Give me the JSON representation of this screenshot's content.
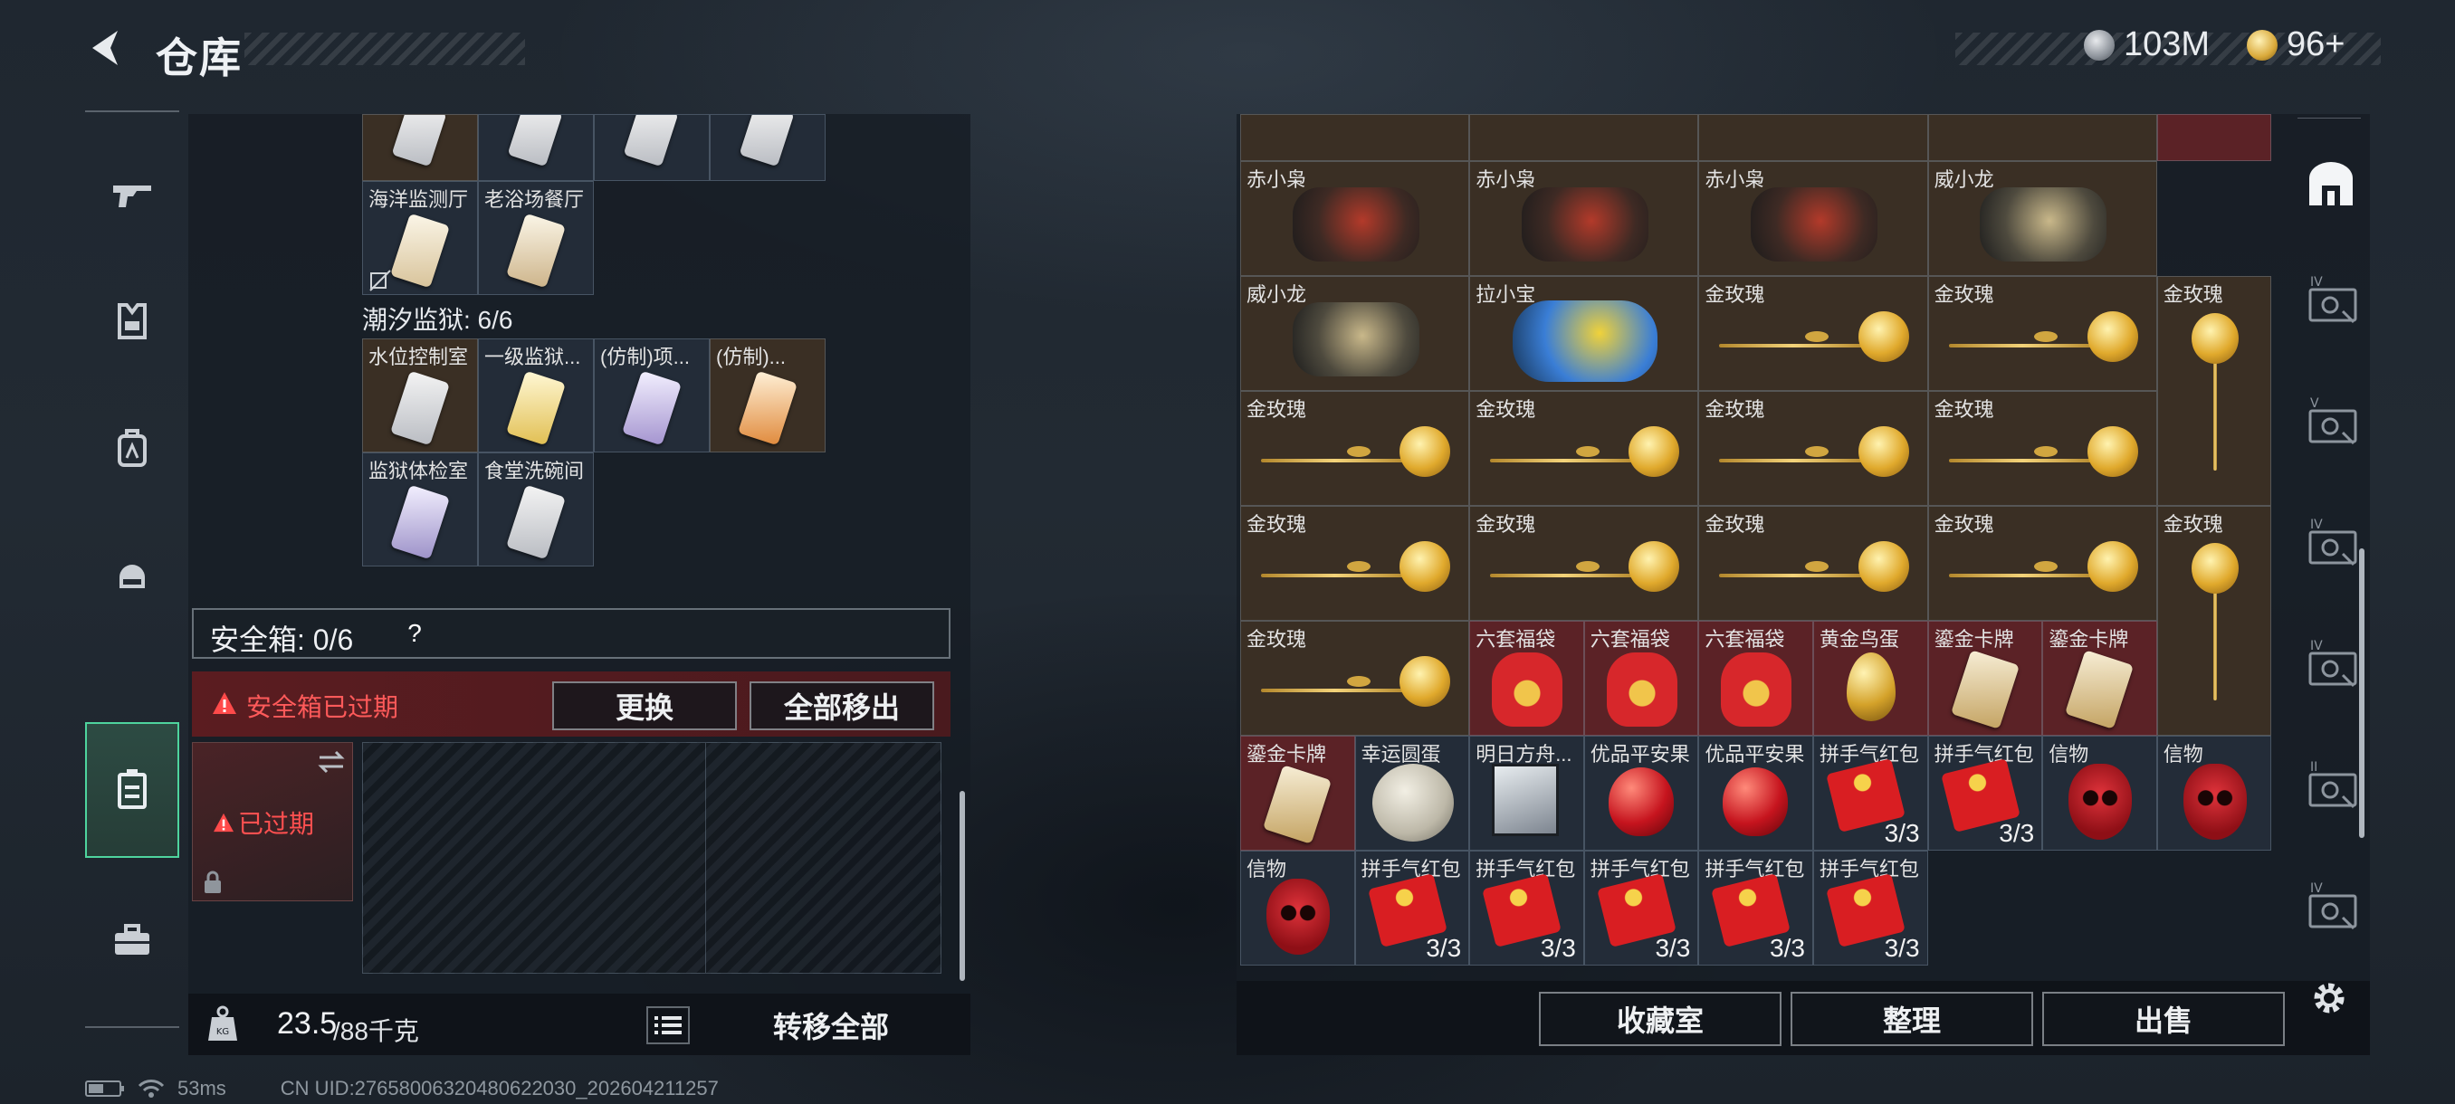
{
  "header": {
    "title": "仓库",
    "currency1": "103M",
    "currency2": "96+"
  },
  "nav": {
    "items": [
      "weapon-icon",
      "armor-icon",
      "backpack-icon",
      "helmet-icon",
      "safebox-icon",
      "toolbox-icon"
    ]
  },
  "left": {
    "row1_labels": [
      "海洋监测厅",
      "老浴场餐厅"
    ],
    "section_title": "潮汐监狱: 6/6",
    "row2_labels": [
      "水位控制室",
      "一级监狱...",
      "(仿制)项...",
      "(仿制)..."
    ],
    "row3_labels": [
      "监狱体检室",
      "食堂洗碗间"
    ],
    "safebox_label": "安全箱: 0/6",
    "safebox_help": "?",
    "expired_warning": "安全箱已过期",
    "replace_button": "更换",
    "move_all_out_button": "全部移出",
    "expired_badge": "已过期",
    "weight_value": "23.5",
    "weight_capacity": "/88千克",
    "transfer_all_button": "转移全部"
  },
  "right": {
    "rows": [
      [
        {
          "label": "赤小枭",
          "bg": "brown"
        },
        {
          "label": "赤小枭",
          "bg": "brown"
        },
        {
          "label": "赤小枭",
          "bg": "brown"
        },
        {
          "label": "威小龙",
          "bg": "brown"
        }
      ],
      [
        {
          "label": "威小龙",
          "bg": "brown"
        },
        {
          "label": "拉小宝",
          "bg": "brown"
        },
        {
          "label": "金玫瑰",
          "bg": "brown"
        },
        {
          "label": "金玫瑰",
          "bg": "brown"
        },
        {
          "label": "金玫瑰",
          "bg": "brown"
        }
      ],
      [
        {
          "label": "金玫瑰",
          "bg": "brown"
        },
        {
          "label": "金玫瑰",
          "bg": "brown"
        },
        {
          "label": "金玫瑰",
          "bg": "brown"
        },
        {
          "label": "金玫瑰",
          "bg": "brown"
        }
      ],
      [
        {
          "label": "金玫瑰",
          "bg": "brown"
        },
        {
          "label": "金玫瑰",
          "bg": "brown"
        },
        {
          "label": "金玫瑰",
          "bg": "brown"
        },
        {
          "label": "金玫瑰",
          "bg": "brown"
        },
        {
          "label": "金玫瑰",
          "bg": "brown"
        }
      ],
      [
        {
          "label": "金玫瑰",
          "bg": "brown"
        },
        {
          "label": "六套福袋",
          "bg": "red"
        },
        {
          "label": "六套福袋",
          "bg": "red"
        },
        {
          "label": "六套福袋",
          "bg": "red"
        },
        {
          "label": "黄金鸟蛋",
          "bg": "red"
        },
        {
          "label": "鎏金卡牌",
          "bg": "red"
        },
        {
          "label": "鎏金卡牌",
          "bg": "red"
        }
      ],
      [
        {
          "label": "鎏金卡牌",
          "bg": "red"
        },
        {
          "label": "幸运圆蛋",
          "bg": "dark"
        },
        {
          "label": "明日方舟...",
          "bg": "dark"
        },
        {
          "label": "优品平安果",
          "bg": "dark"
        },
        {
          "label": "优品平安果",
          "bg": "dark"
        },
        {
          "label": "拼手气红包",
          "bg": "dark",
          "count": "3/3"
        },
        {
          "label": "拼手气红包",
          "bg": "dark",
          "count": "3/3"
        },
        {
          "label": "信物",
          "bg": "dark"
        },
        {
          "label": "信物",
          "bg": "dark"
        }
      ],
      [
        {
          "label": "信物",
          "bg": "dark"
        },
        {
          "label": "拼手气红包",
          "bg": "dark",
          "count": "3/3"
        },
        {
          "label": "拼手气红包",
          "bg": "dark",
          "count": "3/3"
        },
        {
          "label": "拼手气红包",
          "bg": "dark",
          "count": "3/3"
        },
        {
          "label": "拼手气红包",
          "bg": "dark",
          "count": "3/3"
        },
        {
          "label": "拼手气红包",
          "bg": "dark",
          "count": "3/3"
        }
      ]
    ],
    "collection_button": "收藏室",
    "sort_button": "整理",
    "sell_button": "出售"
  },
  "right_nav": [
    "home-icon",
    "map-badge-icon",
    "map-badge-icon",
    "map-badge-icon",
    "map-badge-icon",
    "map-badge-icon",
    "map-badge-icon"
  ],
  "status": {
    "ping": "53ms",
    "uid": "CN UID:2765800632048062203​0_202604211257"
  }
}
